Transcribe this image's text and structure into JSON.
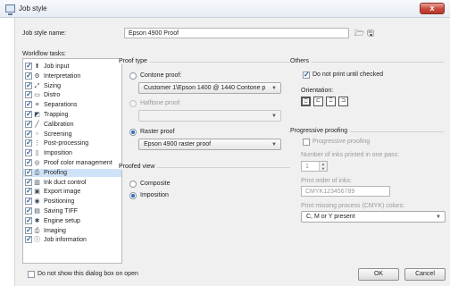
{
  "window": {
    "title": "Job style",
    "close_label": "x"
  },
  "job_style_name": {
    "label": "Job style name:",
    "value": "Epson 4900 Proof"
  },
  "workflow_tasks": {
    "label": "Workflow tasks:",
    "items": [
      {
        "label": "Job input",
        "icon": "job-input-icon",
        "glyph": "⬆",
        "checked": true
      },
      {
        "label": "Interpretation",
        "icon": "interpretation-icon",
        "glyph": "⚙",
        "checked": true
      },
      {
        "label": "Sizing",
        "icon": "sizing-icon",
        "glyph": "⤢",
        "checked": true
      },
      {
        "label": "Distro",
        "icon": "distro-icon",
        "glyph": "▭",
        "checked": true
      },
      {
        "label": "Separations",
        "icon": "separations-icon",
        "glyph": "≡",
        "checked": true
      },
      {
        "label": "Trapping",
        "icon": "trapping-icon",
        "glyph": "◩",
        "checked": true
      },
      {
        "label": "Calibration",
        "icon": "calibration-icon",
        "glyph": "╱",
        "checked": true
      },
      {
        "label": "Screening",
        "icon": "screening-icon",
        "glyph": "⁘",
        "checked": true
      },
      {
        "label": "Post-processing",
        "icon": "post-processing-icon",
        "glyph": "⋮",
        "checked": true
      },
      {
        "label": "Imposition",
        "icon": "imposition-icon",
        "glyph": "▯",
        "checked": true
      },
      {
        "label": "Proof color management",
        "icon": "color-management-icon",
        "glyph": "◎",
        "checked": true
      },
      {
        "label": "Proofing",
        "icon": "proofing-icon",
        "glyph": "⎙",
        "checked": true
      },
      {
        "label": "Ink duct control",
        "icon": "ink-duct-icon",
        "glyph": "▥",
        "checked": true
      },
      {
        "label": "Export image",
        "icon": "export-image-icon",
        "glyph": "▣",
        "checked": true
      },
      {
        "label": "Positioning",
        "icon": "positioning-icon",
        "glyph": "◉",
        "checked": true
      },
      {
        "label": "Saving TIFF",
        "icon": "saving-tiff-icon",
        "glyph": "▤",
        "checked": true
      },
      {
        "label": "Engine setup",
        "icon": "engine-setup-icon",
        "glyph": "✱",
        "checked": true
      },
      {
        "label": "Imaging",
        "icon": "imaging-icon",
        "glyph": "⎙",
        "checked": true
      },
      {
        "label": "Job information",
        "icon": "job-information-icon",
        "glyph": "ⓘ",
        "checked": true
      }
    ],
    "selected_index": 11
  },
  "proof_type": {
    "title": "Proof type",
    "contone": {
      "label": "Contone proof:",
      "value": "Customer 1\\Epson 1400 @ 1440 Contone p",
      "selected": false
    },
    "halftone": {
      "label": "Halftone proof:",
      "value": "",
      "selected": false,
      "disabled": true
    },
    "raster": {
      "label": "Raster proof",
      "value": "Epson 4900 raster proof",
      "selected": true
    }
  },
  "proofed_view": {
    "title": "Proofed view",
    "options": [
      {
        "label": "Composite",
        "selected": false
      },
      {
        "label": "Imposition",
        "selected": true
      }
    ]
  },
  "others": {
    "title": "Others",
    "do_not_print": {
      "label": "Do not print until checked",
      "checked": true
    },
    "orientation_label": "Orientation:"
  },
  "progressive": {
    "title": "Progressive proofing",
    "checkbox": {
      "label": "Progressive proofing",
      "checked": false
    },
    "inks_label": "Number of inks printed in one pass:",
    "inks_value": "1",
    "order_label": "Print order of inks:",
    "order_value": "CMYK123456789",
    "missing_label": "Print missing process (CMYK) colors:",
    "missing_value": "C, M or Y present"
  },
  "footer": {
    "dont_show": {
      "label": "Do not show this dialog box on open",
      "checked": false
    },
    "ok_label": "OK",
    "cancel_label": "Cancel"
  }
}
